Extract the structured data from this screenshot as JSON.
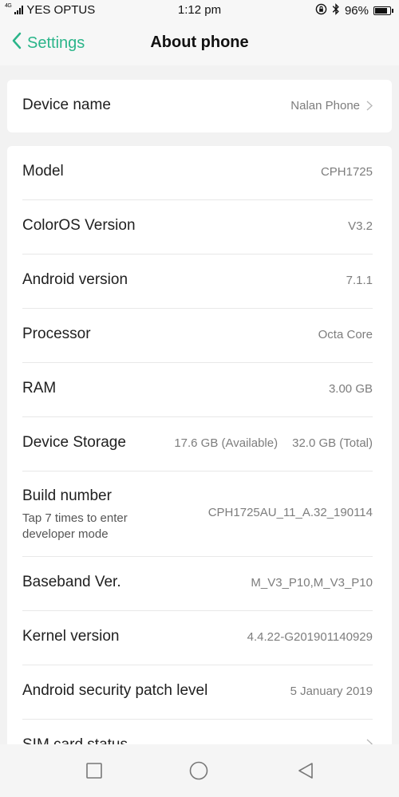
{
  "status_bar": {
    "network_type": "4G",
    "carrier": "YES OPTUS",
    "time": "1:12 pm",
    "battery_percent": "96%",
    "battery_level": 0.96,
    "icons": [
      "lock-rotation-icon",
      "bluetooth-icon",
      "battery-icon"
    ]
  },
  "header": {
    "back_label": "Settings",
    "title": "About phone",
    "accent_color": "#2bb58a"
  },
  "device": {
    "label": "Device name",
    "value": "Nalan Phone"
  },
  "info_rows": [
    {
      "label": "Model",
      "value": "CPH1725"
    },
    {
      "label": "ColorOS Version",
      "value": "V3.2"
    },
    {
      "label": "Android version",
      "value": "7.1.1"
    },
    {
      "label": "Processor",
      "value": "Octa Core"
    },
    {
      "label": "RAM",
      "value": "3.00 GB"
    },
    {
      "label": "Device Storage",
      "available": "17.6 GB (Available)",
      "total": "32.0 GB (Total)"
    },
    {
      "label": "Build number",
      "sublabel": "Tap 7 times to enter developer mode",
      "value": "CPH1725AU_11_A.32_190114"
    },
    {
      "label": "Baseband Ver.",
      "value": "M_V3_P10,M_V3_P10"
    },
    {
      "label": "Kernel version",
      "value": "4.4.22-G201901140929"
    },
    {
      "label": "Android security patch level",
      "value": "5 January 2019"
    },
    {
      "label": "SIM card status",
      "value": ""
    }
  ],
  "nav_bar": {
    "icons": [
      "recents-square-icon",
      "home-circle-icon",
      "back-triangle-icon"
    ]
  }
}
